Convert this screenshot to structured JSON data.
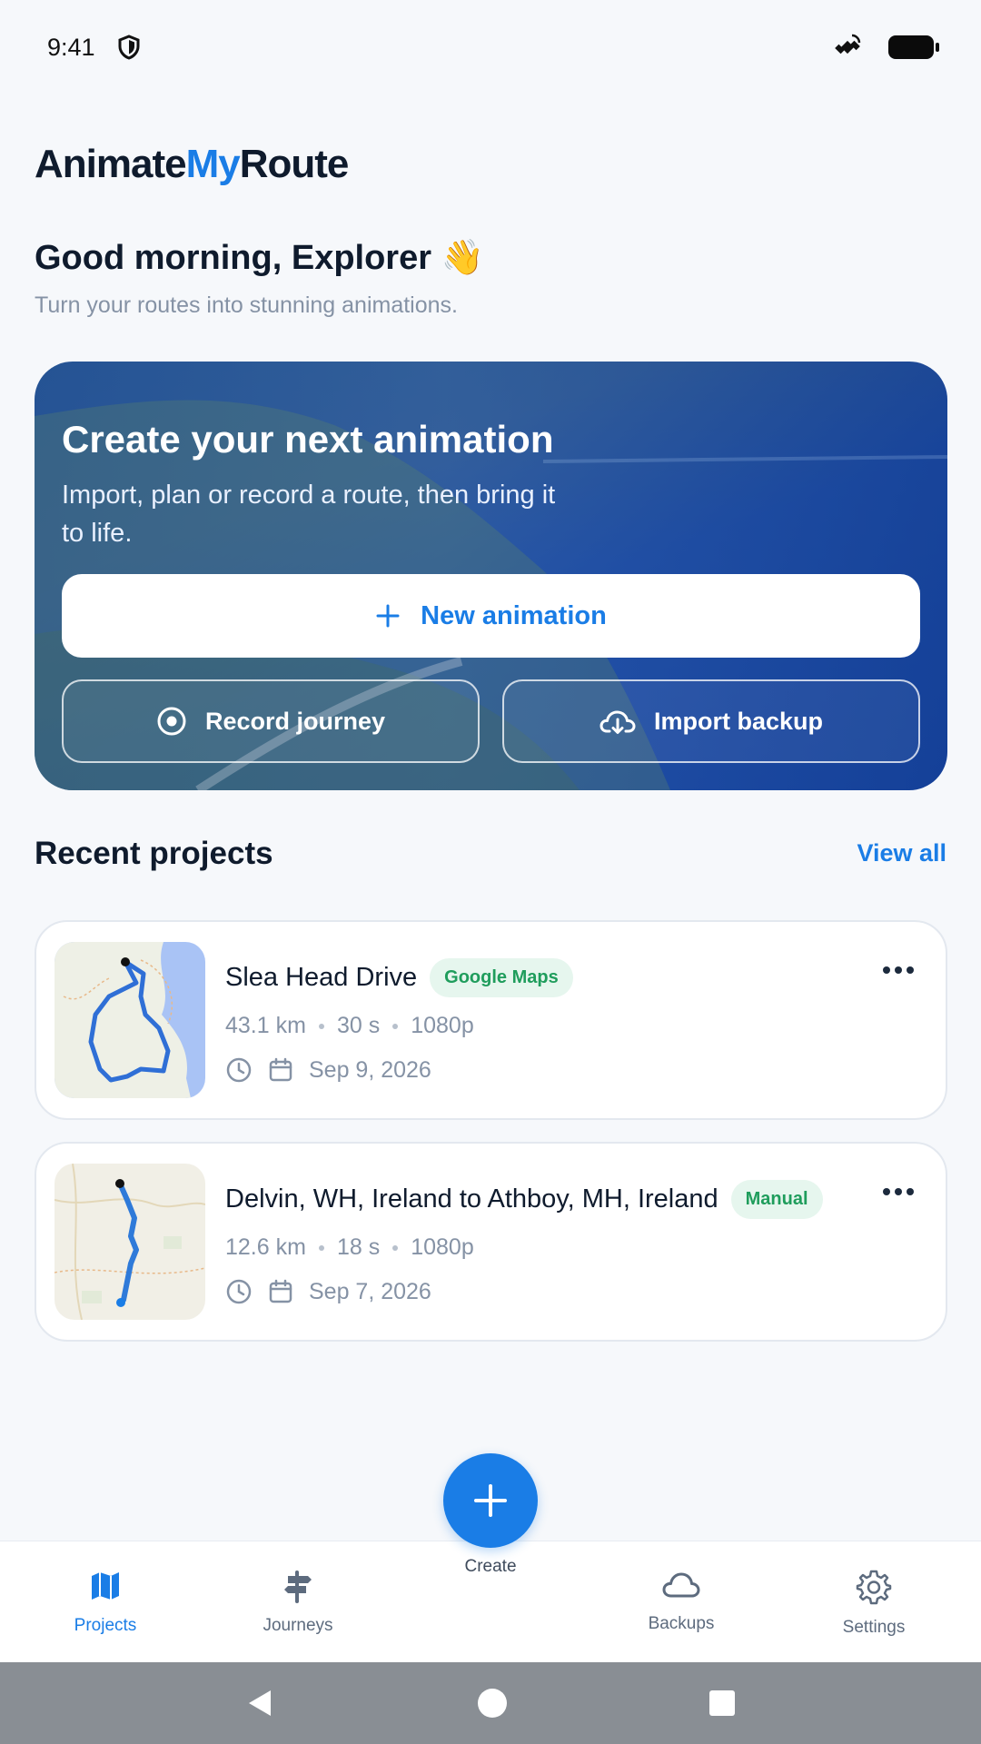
{
  "status_bar": {
    "time": "9:41"
  },
  "app": {
    "name_part1": "Animate",
    "name_part2": "My",
    "name_part3": "Route"
  },
  "greeting": {
    "title": "Good morning, Explorer 👋",
    "subtitle": "Turn your routes into stunning animations."
  },
  "hero": {
    "title": "Create your next animation",
    "description": "Import, plan or record a route, then bring it to life.",
    "primary_button": "New animation",
    "record_button": "Record journey",
    "import_button": "Import backup"
  },
  "recent": {
    "title": "Recent projects",
    "view_all": "View all",
    "projects": [
      {
        "title": "Slea Head Drive",
        "badge": "Google Maps",
        "distance": "43.1 km",
        "duration": "30 s",
        "resolution": "1080p",
        "date": "Sep 9, 2026"
      },
      {
        "title": "Delvin, WH, Ireland to Athboy, MH, Ireland",
        "badge": "Manual",
        "distance": "12.6 km",
        "duration": "18 s",
        "resolution": "1080p",
        "date": "Sep 7, 2026"
      }
    ]
  },
  "bottom_nav": {
    "projects": "Projects",
    "journeys": "Journeys",
    "create": "Create",
    "backups": "Backups",
    "settings": "Settings"
  },
  "colors": {
    "accent": "#1a7de6",
    "badge_green": "#1f9d5c",
    "hero_blue": "#1c47a0"
  }
}
